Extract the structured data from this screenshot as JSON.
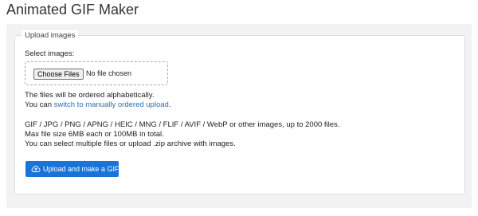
{
  "page": {
    "title": "Animated GIF Maker"
  },
  "upload": {
    "legend": "Upload images",
    "select_label": "Select images:",
    "choose_button": "Choose Files",
    "no_file_text": "No file chosen",
    "order_note": "The files will be ordered alphabetically.",
    "switch_prefix": "You can ",
    "switch_link": "switch to manually ordered upload",
    "switch_suffix": ".",
    "formats_line": "GIF / JPG / PNG / APNG / HEIC / MNG / FLIF / AVIF / WebP or other images, up to 2000 files.",
    "size_line": "Max file size 6MB each or 100MB in total.",
    "multi_line": "You can select multiple files or upload .zip archive with images.",
    "submit_button": "Upload and make a GIF!",
    "submit_icon": "cloud-upload-icon"
  },
  "colors": {
    "accent": "#1a73d9",
    "link": "#2a6db5",
    "panel_bg": "#f2f2f2"
  }
}
